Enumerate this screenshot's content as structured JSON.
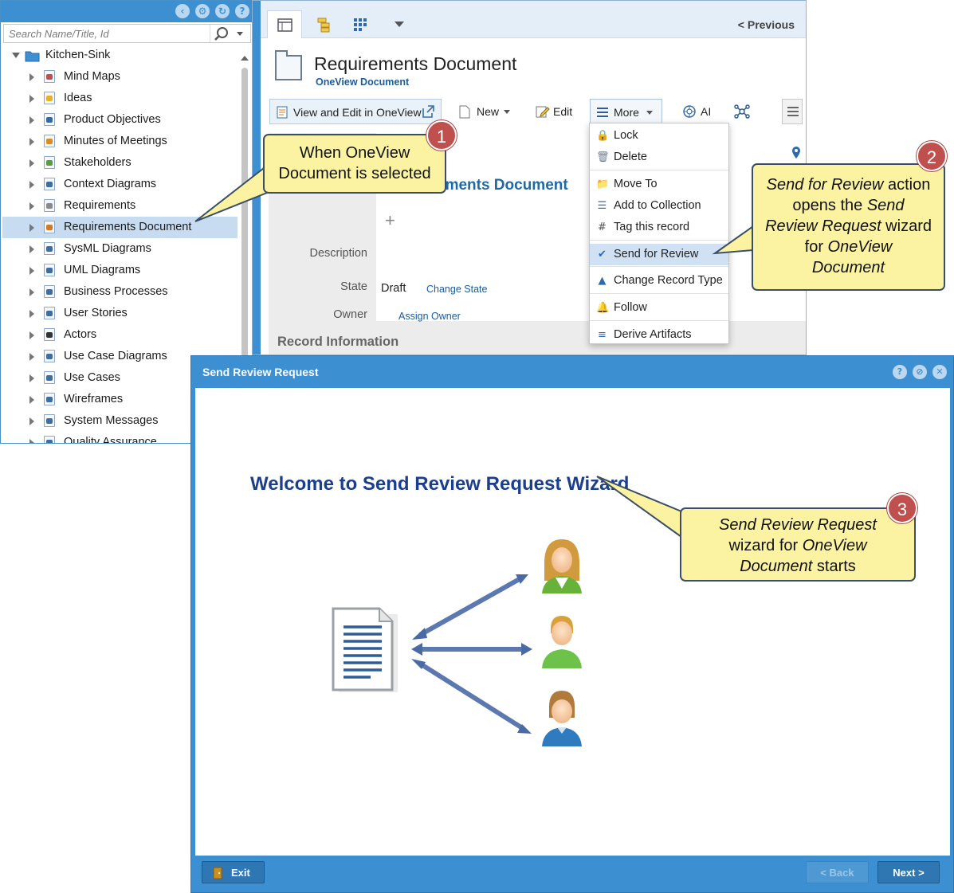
{
  "tree": {
    "toolbar_icons": [
      "back-icon",
      "gear-icon",
      "refresh-icon",
      "help-icon"
    ],
    "search_placeholder": "Search Name/Title, Id",
    "root_label": "Kitchen-Sink",
    "items": [
      {
        "label": "Mind Maps",
        "icon": "mind-map-icon",
        "color": "#c0504d"
      },
      {
        "label": "Ideas",
        "icon": "lightbulb-icon",
        "color": "#e8b220"
      },
      {
        "label": "Product Objectives",
        "icon": "pin-icon",
        "color": "#2d6ab0"
      },
      {
        "label": "Minutes of Meetings",
        "icon": "meeting-icon",
        "color": "#d98c20"
      },
      {
        "label": "Stakeholders",
        "icon": "stakeholders-icon",
        "color": "#5a9e3a"
      },
      {
        "label": "Context Diagrams",
        "icon": "context-diagram-icon",
        "color": "#3a6ea5"
      },
      {
        "label": "Requirements",
        "icon": "requirements-icon",
        "color": "#8a8a8a"
      },
      {
        "label": "Requirements Document",
        "icon": "document-icon",
        "color": "#d0782a",
        "selected": true
      },
      {
        "label": "SysML Diagrams",
        "icon": "folder-icon",
        "color": "#3a6ea5"
      },
      {
        "label": "UML Diagrams",
        "icon": "folder-icon",
        "color": "#3a6ea5"
      },
      {
        "label": "Business Processes",
        "icon": "process-icon",
        "color": "#3a6ea5"
      },
      {
        "label": "User Stories",
        "icon": "user-story-icon",
        "color": "#3a6ea5"
      },
      {
        "label": "Actors",
        "icon": "actor-icon",
        "color": "#333333"
      },
      {
        "label": "Use Case Diagrams",
        "icon": "use-case-diagram-icon",
        "color": "#3a6ea5"
      },
      {
        "label": "Use Cases",
        "icon": "use-case-icon",
        "color": "#3a6ea5"
      },
      {
        "label": "Wireframes",
        "icon": "wireframe-icon",
        "color": "#3a6ea5"
      },
      {
        "label": "System Messages",
        "icon": "message-icon",
        "color": "#3a6ea5"
      },
      {
        "label": "Quality Assurance",
        "icon": "check-icon",
        "color": "#3a6ea5"
      }
    ]
  },
  "main": {
    "prev_label": "< Previous",
    "title": "Requirements Document",
    "subtitle": "OneView Document",
    "toolbar": {
      "view_edit": "View and Edit in OneView",
      "new": "New",
      "edit": "Edit",
      "more": "More",
      "ai": "AI"
    },
    "heading_fragment": "ements Document",
    "plus": "+",
    "fields": {
      "description_label": "Description",
      "state_label": "State",
      "state_value": "Draft",
      "state_link": "Change State",
      "owner_label": "Owner",
      "owner_link": "Assign Owner"
    },
    "record_info": "Record Information"
  },
  "menu": {
    "items": [
      {
        "label": "Lock",
        "icon": "lock-icon"
      },
      {
        "label": "Delete",
        "icon": "trash-icon"
      },
      {
        "label": "Move To",
        "icon": "move-icon"
      },
      {
        "label": "Add to Collection",
        "icon": "collection-icon"
      },
      {
        "label": "Tag this record",
        "icon": "hash-icon"
      },
      {
        "label": "Send for Review",
        "icon": "review-icon",
        "highlighted": true
      },
      {
        "label": "Change Record Type",
        "icon": "shapes-icon"
      },
      {
        "label": "Follow",
        "icon": "bell-icon"
      },
      {
        "label": "Derive Artifacts",
        "icon": "derive-icon"
      }
    ]
  },
  "callouts": {
    "c1": {
      "badge": "1",
      "line1": "When OneView",
      "line2": "Document is selected"
    },
    "c2": {
      "badge": "2",
      "l1a": "Send for Review",
      "l1b": " action",
      "l2a": "opens the ",
      "l2b": "Send",
      "l3a": "Review Request",
      "l3b": " wizard",
      "l4a": "for ",
      "l4b": "OneView",
      "l5": "Document"
    },
    "c3": {
      "badge": "3",
      "l1": "Send Review Request",
      "l2a": "wizard for ",
      "l2b": "OneView",
      "l3a": "Document",
      "l3b": " starts"
    }
  },
  "dialog": {
    "title": "Send Review Request",
    "wizard_title": "Welcome to Send Review Request Wizard",
    "exit": "Exit",
    "back": "< Back",
    "next": "Next >"
  },
  "colors": {
    "accent": "#3c8fd0",
    "callout_fill": "#fbf3a2",
    "badge": "#c0504d",
    "title_blue": "#1b3f8b"
  }
}
